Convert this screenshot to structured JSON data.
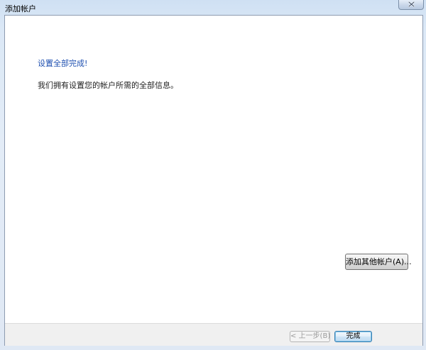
{
  "window": {
    "title": "添加帐户"
  },
  "main": {
    "heading": "设置全部完成!",
    "description": "我们拥有设置您的帐户所需的全部信息。",
    "add_other_account_button": "添加其他帐户(A)..."
  },
  "footer": {
    "back_button": "< 上一步(B)",
    "finish_button": "完成"
  },
  "colors": {
    "heading": "#1e4fb0",
    "client_background": "#ffffff",
    "footer_background": "#f0f0f0"
  },
  "icons": {
    "close": "close-icon"
  }
}
